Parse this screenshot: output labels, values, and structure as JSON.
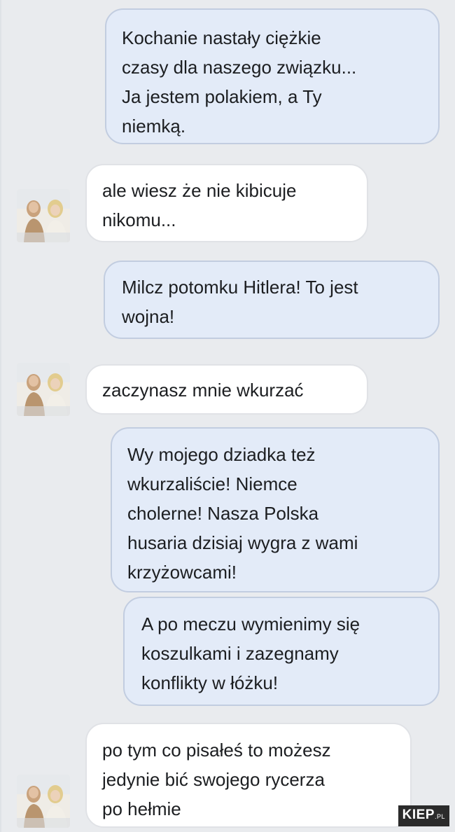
{
  "messages": [
    {
      "direction": "out",
      "text": "Kochanie nastały ciężkie\nczasy dla naszego związku...\nJa jestem polakiem, a Ty\nniemką."
    },
    {
      "direction": "in",
      "text": "ale wiesz że nie kibicuje\nnikomu..."
    },
    {
      "direction": "out",
      "text": "Milcz potomku Hitlera! To jest\nwojna!"
    },
    {
      "direction": "in",
      "text": "zaczynasz mnie wkurzać"
    },
    {
      "direction": "out",
      "text": "Wy mojego dziadka też\nwkurzaliście! Niemce\ncholerne! Nasza Polska\nhusaria dzisiaj wygra z wami\nkrzyżowcami!"
    },
    {
      "direction": "out",
      "text": "A po meczu wymienimy się\nkoszulkami i zazegnamy\nkonflikty w łóżku!"
    },
    {
      "direction": "in",
      "text": "po tym co pisałeś to możesz\njedynie bić swojego rycerza\npo hełmie"
    }
  ],
  "watermark": {
    "main": "KIEP",
    "sub": ".PL"
  },
  "colors": {
    "background": "#e9ebee",
    "outgoing_bubble": "#e3ebf8",
    "incoming_bubble": "#ffffff",
    "text": "#1c1e21"
  }
}
